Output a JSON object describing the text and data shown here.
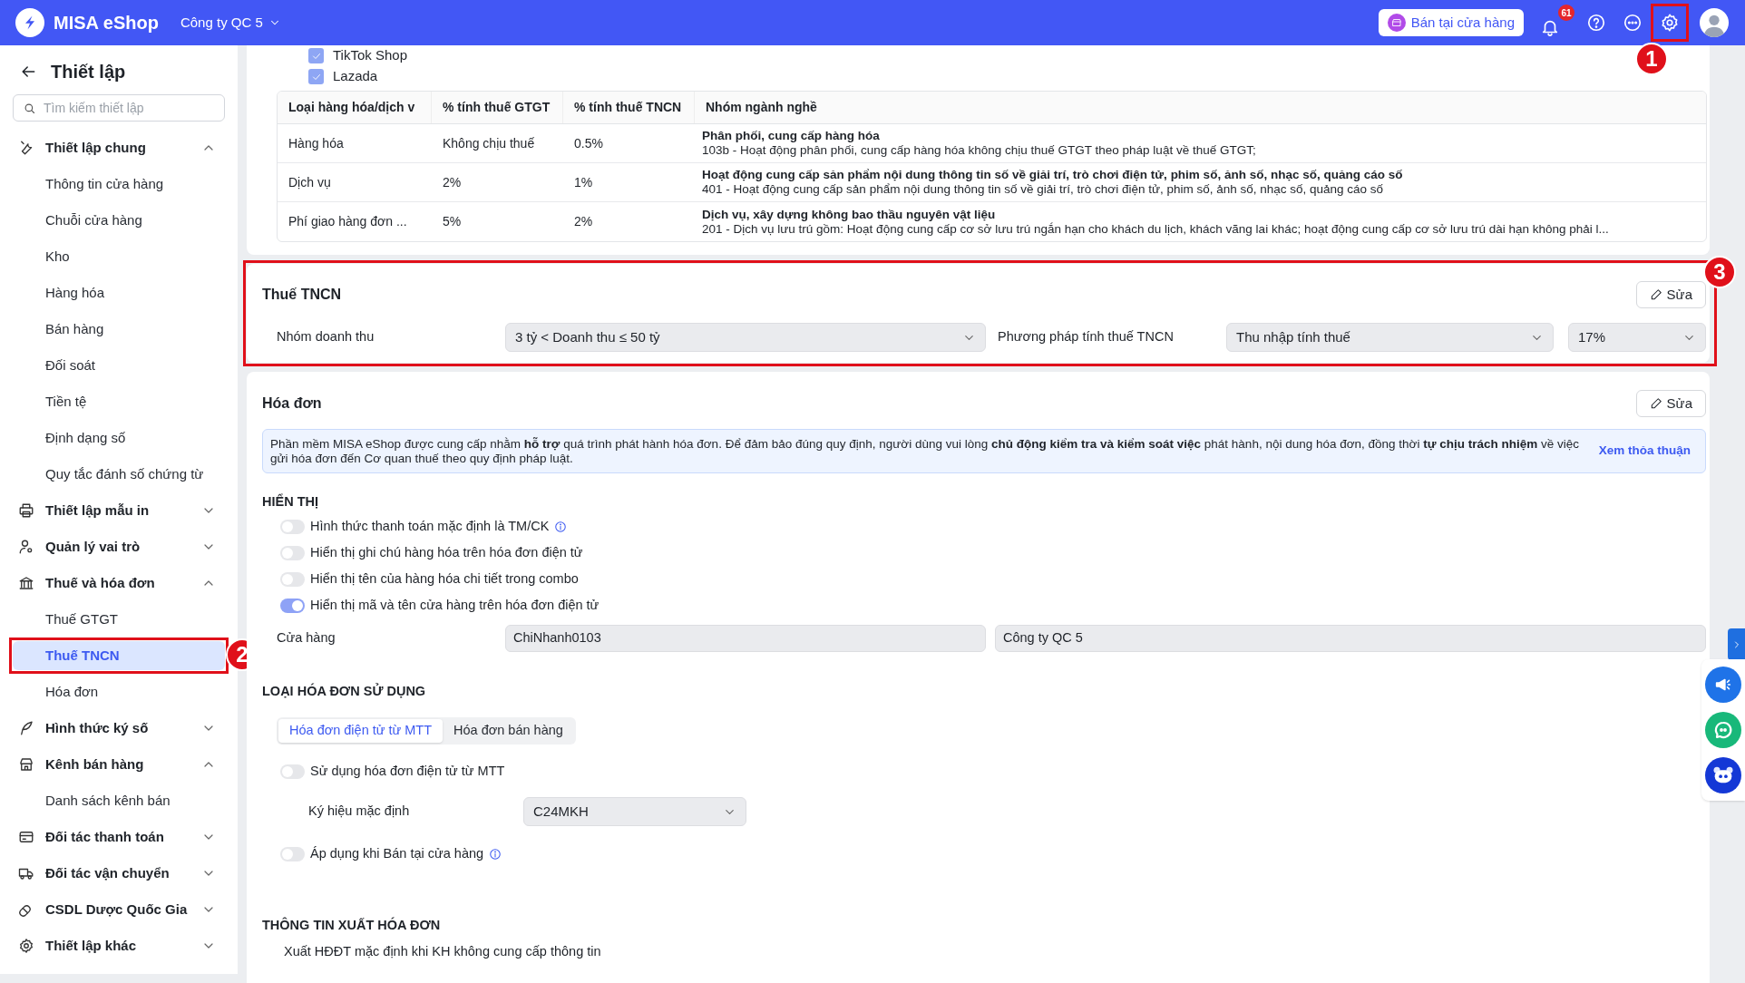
{
  "header": {
    "logo_text": "MISA eShop",
    "company": "Công ty QC 5",
    "store_button": "Bán tại cửa hàng",
    "notification_count": "61"
  },
  "annotations": [
    {
      "label": "1"
    },
    {
      "label": "2"
    },
    {
      "label": "3"
    }
  ],
  "sidebar": {
    "title": "Thiết lập",
    "search_placeholder": "Tìm kiếm thiết lập",
    "groups": [
      {
        "label": "Thiết lập chung",
        "expanded": true,
        "children": [
          {
            "label": "Thông tin cửa hàng",
            "selected": false
          },
          {
            "label": "Chuỗi cửa hàng",
            "selected": false
          },
          {
            "label": "Kho",
            "selected": false
          },
          {
            "label": "Hàng hóa",
            "selected": false
          },
          {
            "label": "Bán hàng",
            "selected": false
          },
          {
            "label": "Đối soát",
            "selected": false
          },
          {
            "label": "Tiền tệ",
            "selected": false
          },
          {
            "label": "Định dạng số",
            "selected": false
          },
          {
            "label": "Quy tắc đánh số chứng từ",
            "selected": false
          }
        ]
      },
      {
        "label": "Thiết lập mẫu in",
        "expanded": false
      },
      {
        "label": "Quản lý vai trò",
        "expanded": false
      },
      {
        "label": "Thuế và hóa đơn",
        "expanded": true,
        "children": [
          {
            "label": "Thuế GTGT",
            "selected": false
          },
          {
            "label": "Thuế TNCN",
            "selected": true
          },
          {
            "label": "Hóa đơn",
            "selected": false
          }
        ]
      },
      {
        "label": "Hình thức ký số",
        "expanded": false
      },
      {
        "label": "Kênh bán hàng",
        "expanded": true,
        "children": [
          {
            "label": "Danh sách kênh bán",
            "selected": false
          }
        ]
      },
      {
        "label": "Đối tác thanh toán",
        "expanded": false
      },
      {
        "label": "Đối tác vận chuyển",
        "expanded": false
      },
      {
        "label": "CSDL Dược Quốc Gia",
        "expanded": false
      },
      {
        "label": "Thiết lập khác",
        "expanded": false
      }
    ]
  },
  "sales_channels": [
    {
      "label": "TikTok Shop",
      "checked": true
    },
    {
      "label": "Lazada",
      "checked": true
    }
  ],
  "tax_table": {
    "columns": [
      "Loại hàng hóa/dịch v",
      "% tính thuế GTGT",
      "% tính thuế TNCN",
      "Nhóm ngành nghề"
    ],
    "rows": [
      {
        "cells": [
          "Hàng hóa",
          "Không chịu thuế",
          "0.5%"
        ],
        "industry_title": "Phân phối, cung cấp hàng hóa",
        "industry_detail": "103b - Hoạt động phân phối, cung cấp hàng hóa không chịu thuế GTGT theo pháp luật về thuế GTGT;"
      },
      {
        "cells": [
          "Dịch vụ",
          "2%",
          "1%"
        ],
        "industry_title": "Hoạt động cung cấp sản phẩm nội dung thông tin số về giải trí, trò chơi điện tử, phim số, ảnh số, nhạc số, quảng cáo số",
        "industry_detail": "401 - Hoạt động cung cấp sản phẩm nội dung thông tin số về giải trí, trò chơi điện tử, phim số, ảnh số, nhạc số, quảng cáo số"
      },
      {
        "cells": [
          "Phí giao hàng đơn ...",
          "5%",
          "2%"
        ],
        "industry_title": "Dịch vụ, xây dựng không bao thầu nguyên vật liệu",
        "industry_detail": "201 - Dịch vụ lưu trú gồm: Hoạt động cung cấp cơ sở lưu trú ngắn hạn cho khách du lịch, khách vãng lai khác; hoạt động cung cấp cơ sở lưu trú dài hạn không phải l..."
      }
    ]
  },
  "pit_section": {
    "title": "Thuế TNCN",
    "edit_button": "Sửa",
    "revenue_label": "Nhóm doanh thu",
    "revenue_value": "3 tỷ < Doanh thu ≤ 50 tỷ",
    "method_label": "Phương pháp tính thuế TNCN",
    "method_value": "Thu nhập tính thuế",
    "rate_value": "17%"
  },
  "invoice_section": {
    "title": "Hóa đơn",
    "edit_button": "Sửa",
    "notice": "Phần mềm MISA eShop được cung cấp nhằm **hỗ trợ** quá trình phát hành hóa đơn. Để đảm bảo đúng quy định, người dùng vui lòng **chủ động kiểm tra và kiểm soát việc** phát hành, nội dung hóa đơn, đồng thời **tự chịu trách nhiệm** về việc gửi hóa đơn đến Cơ quan thuế theo quy định pháp luật.",
    "notice_link": "Xem thỏa thuận",
    "display_heading": "HIỂN THỊ",
    "display_options": [
      {
        "label": "Hình thức thanh toán mặc định là TM/CK",
        "on": false,
        "info": true
      },
      {
        "label": "Hiển thị ghi chú hàng hóa trên hóa đơn điện tử",
        "on": false,
        "info": false
      },
      {
        "label": "Hiển thị tên của hàng hóa chi tiết trong combo",
        "on": false,
        "info": false
      },
      {
        "label": "Hiển thị mã và tên cửa hàng trên hóa đơn điện tử",
        "on": true,
        "info": false
      }
    ],
    "store_label": "Cửa hàng",
    "store_code": "ChiNhanh0103",
    "store_company": "Công ty QC 5",
    "type_heading": "LOẠI HÓA ĐƠN SỬ DỤNG",
    "tabs": [
      {
        "label": "Hóa đơn điện tử từ MTT",
        "selected": true
      },
      {
        "label": "Hóa đơn bán hàng",
        "selected": false
      }
    ],
    "use_mtt": {
      "label": "Sử dụng hóa đơn điện tử từ MTT",
      "on": false,
      "info": false
    },
    "symbol_label": "Ký hiệu mặc định",
    "symbol_value": "C24MKH",
    "apply_store": {
      "label": "Áp dụng khi Bán tại cửa hàng",
      "on": false,
      "info": true
    },
    "export_heading": "THÔNG TIN XUẤT HÓA ĐƠN",
    "export_text": "Xuất HĐĐT mặc định khi KH không cung cấp thông tin"
  }
}
